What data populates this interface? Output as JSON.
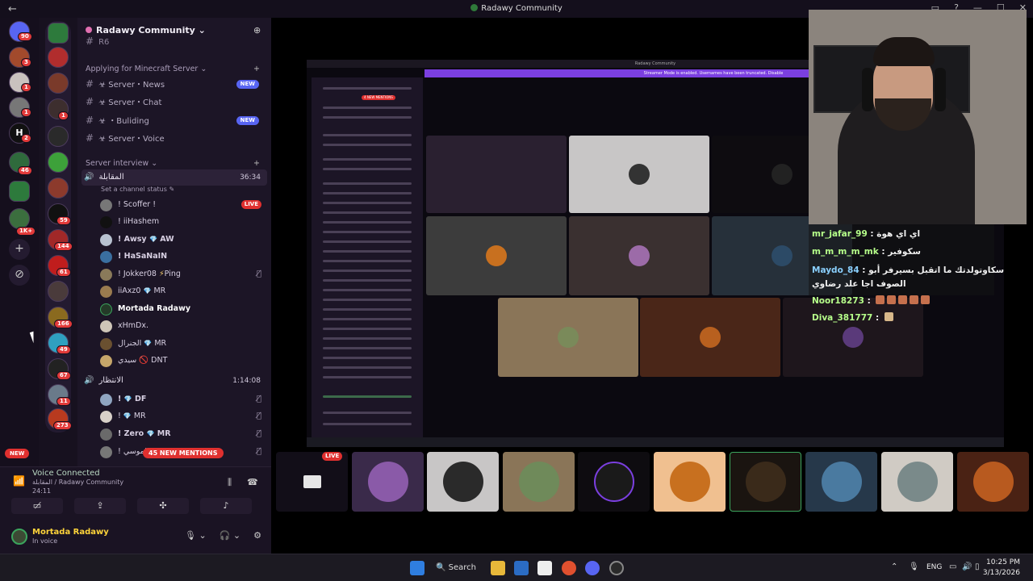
{
  "window": {
    "title": "Radawy Community"
  },
  "rail_badges": [
    "90",
    "3",
    "1",
    "1",
    "2",
    "46",
    "1K+"
  ],
  "rail2_badges": [
    "1",
    "59",
    "144",
    "61",
    "166",
    "49",
    "67",
    "11",
    "273"
  ],
  "server": {
    "name": "Radawy Community"
  },
  "channels": {
    "top_stub": "R6",
    "cat1": "Applying for Minecraft Server",
    "items": [
      {
        "label": "Server・News",
        "badge": "NEW"
      },
      {
        "label": "Server・Chat",
        "badge": ""
      },
      {
        "label": "Buliding",
        "badge": "NEW"
      },
      {
        "label": "Server・Voice",
        "badge": ""
      }
    ],
    "cat2": "Server interview",
    "vc1": {
      "name": "المقابلة",
      "time": "36:34",
      "status": "Set a channel status"
    },
    "vc1_users": [
      {
        "name": "! Scoffer !",
        "tag": "",
        "live": "LIVE"
      },
      {
        "name": "! iiHashem",
        "tag": ""
      },
      {
        "name": "! Awsy",
        "tag": "AW"
      },
      {
        "name": "! HaSaNaIN",
        "tag": ""
      },
      {
        "name": "! Jokker08",
        "tag": "Ping"
      },
      {
        "name": "iiAxz0",
        "tag": "MR"
      },
      {
        "name": "Mortada Radawy",
        "tag": ""
      },
      {
        "name": "xHmDx.",
        "tag": ""
      },
      {
        "name": "الجنرال",
        "tag": "MR"
      },
      {
        "name": "سيدي",
        "tag": "DNT"
      }
    ],
    "vc2": {
      "name": "الانتظار",
      "time": "1:14:08"
    },
    "vc2_users": [
      {
        "name": "!",
        "tag": "DF"
      },
      {
        "name": "!",
        "tag": "MR"
      },
      {
        "name": "! Zero",
        "tag": "MR"
      },
      {
        "name": "! الموسي",
        "tag": ""
      }
    ],
    "mentions_pill": "45 NEW MENTIONS",
    "new_pill": "NEW"
  },
  "voice": {
    "status": "Voice Connected",
    "location": "المقابلة / Radawy Community",
    "elapsed": "24:11"
  },
  "user": {
    "name": "Mortada Radawy",
    "sub": "In voice"
  },
  "stream": {
    "title": "Radawy Community",
    "banner": "Streamer Mode is enabled. Usernames have been truncated.  Disable",
    "mini_tag": "4 NEW MENTIONS"
  },
  "chat": [
    {
      "user": "mr_jafar_99",
      "msg": "اي اي هوة"
    },
    {
      "user": "m_m_m_m_mk",
      "msg": "سكوفير"
    },
    {
      "user": "Maydo_84",
      "msg": "سكاوتولدتك ما اتقبل بسيرفر أبو الصوف اجا علد رضاوي"
    },
    {
      "user": "Noor18273",
      "msg": ""
    },
    {
      "user": "Diva_381777",
      "msg": ""
    }
  ],
  "strip": {
    "live": "LIVE"
  },
  "taskbar": {
    "search": "Search",
    "lang": "ENG",
    "time": "10:25 PM",
    "date": "3/13/2026"
  },
  "colors": {
    "live": "#e0302f",
    "accent": "#5865f2",
    "online": "#3ba55d",
    "streamer": "#7b3fe0"
  }
}
